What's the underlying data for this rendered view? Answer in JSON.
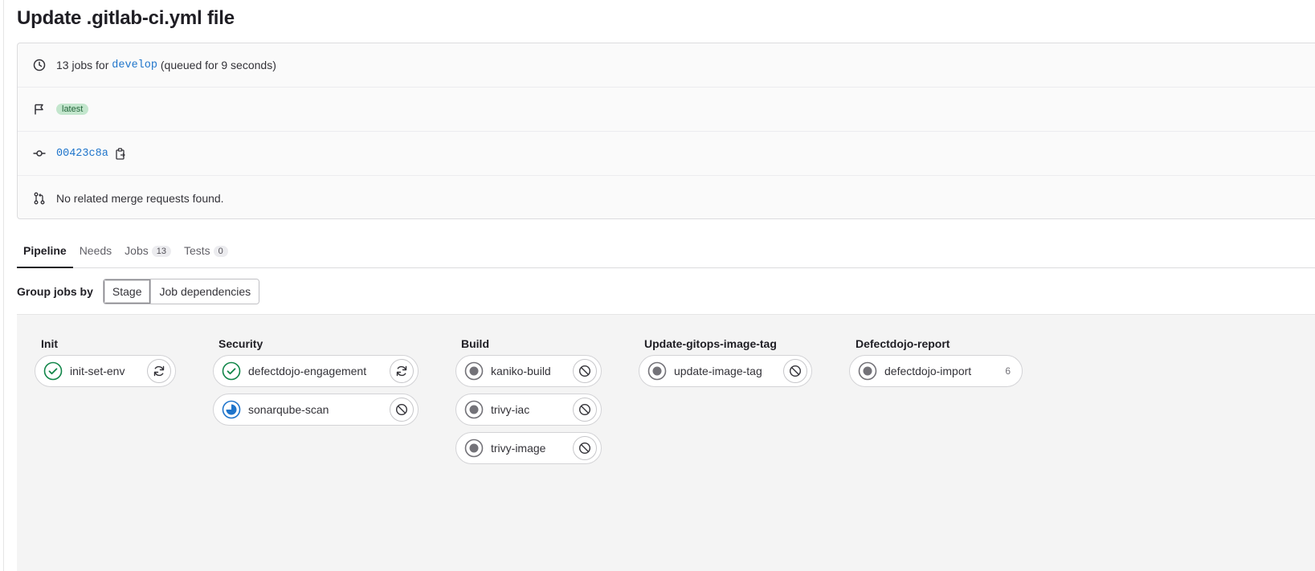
{
  "page": {
    "title": "Update .gitlab-ci.yml file"
  },
  "info": {
    "jobs_prefix": "13 jobs for",
    "branch": "develop",
    "queued": "(queued for 9 seconds)",
    "badge": "latest",
    "commit_sha": "00423c8a",
    "merge_requests": "No related merge requests found."
  },
  "tabs": [
    {
      "label": "Pipeline",
      "count": null,
      "active": true
    },
    {
      "label": "Needs",
      "count": null
    },
    {
      "label": "Jobs",
      "count": "13"
    },
    {
      "label": "Tests",
      "count": "0"
    }
  ],
  "group_by": {
    "label": "Group jobs by",
    "options": [
      "Stage",
      "Job dependencies"
    ],
    "selected": "Stage"
  },
  "stages": [
    {
      "name": "Init",
      "jobs": [
        {
          "name": "init-set-env",
          "status": "success",
          "action": "retry"
        }
      ]
    },
    {
      "name": "Security",
      "jobs": [
        {
          "name": "defectdojo-engagement",
          "status": "success",
          "action": "retry"
        },
        {
          "name": "sonarqube-scan",
          "status": "running",
          "action": "cancel"
        }
      ]
    },
    {
      "name": "Build",
      "jobs": [
        {
          "name": "kaniko-build",
          "status": "created",
          "action": "cancel"
        },
        {
          "name": "trivy-iac",
          "status": "created",
          "action": "cancel"
        },
        {
          "name": "trivy-image",
          "status": "created",
          "action": "cancel"
        }
      ]
    },
    {
      "name": "Update-gitops-image-tag",
      "jobs": [
        {
          "name": "update-image-tag",
          "status": "created",
          "action": "cancel"
        }
      ]
    },
    {
      "name": "Defectdojo-report",
      "jobs": [
        {
          "name": "defectdojo-import",
          "status": "created",
          "action": null,
          "count": "6"
        }
      ]
    }
  ],
  "colors": {
    "success": "#108548",
    "running": "#1f75cb",
    "created": "#737278",
    "link": "#1f75cb"
  },
  "icons": [
    "clock-icon",
    "flag-icon",
    "commit-icon",
    "copy-icon",
    "merge-request-icon",
    "status-success-icon",
    "status-running-icon",
    "status-created-icon",
    "retry-icon",
    "cancel-icon"
  ]
}
